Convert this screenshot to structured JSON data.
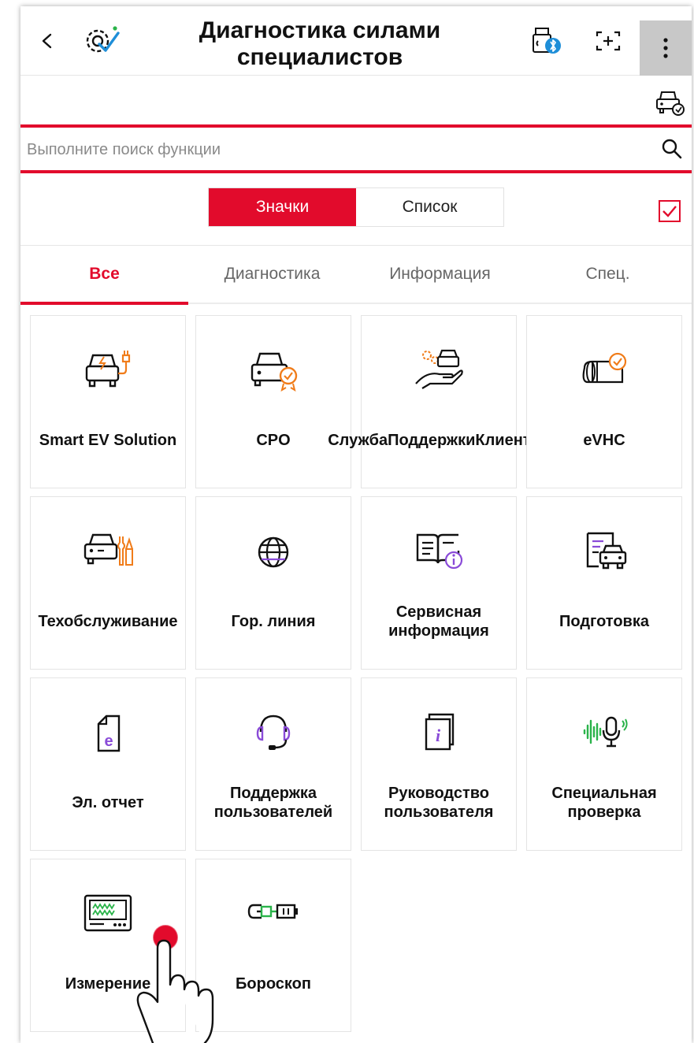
{
  "header": {
    "title": "Диагностика силами специалистов",
    "back_icon": "chevron-left-icon",
    "logo_icon": "diagnostic-gear-check-icon",
    "vci_icon": "vci-bluetooth-icon",
    "capture_icon": "screen-capture-icon",
    "more_icon": "more-vertical-icon",
    "vehicle_icon": "vehicle-clock-icon"
  },
  "search": {
    "placeholder": "Выполните поиск функции",
    "value": ""
  },
  "view_toggle": {
    "options": [
      "Значки",
      "Список"
    ],
    "selected": "Значки",
    "checkbox_checked": true
  },
  "tabs": {
    "items": [
      "Все",
      "Диагностика",
      "Информация",
      "Спец."
    ],
    "active": "Все"
  },
  "tiles": [
    {
      "label": "Smart EV Solution",
      "icon": "ev-charging-car-icon"
    },
    {
      "label": "CPO",
      "icon": "car-certified-badge-icon"
    },
    {
      "label": "СлужбаПоддержкиКлиентов",
      "icon": "customer-care-hand-icon"
    },
    {
      "label": "eVHC",
      "icon": "vehicle-health-check-icon"
    },
    {
      "label": "Техобслуживание",
      "icon": "car-maintenance-tools-icon"
    },
    {
      "label": "Гор. линия",
      "icon": "globe-icon"
    },
    {
      "label": "Сервисная информация",
      "icon": "service-info-book-icon"
    },
    {
      "label": "Подготовка",
      "icon": "document-car-icon"
    },
    {
      "label": "Эл. отчет",
      "icon": "e-report-document-icon"
    },
    {
      "label": "Поддержка пользователей",
      "icon": "headset-icon"
    },
    {
      "label": "Руководство пользователя",
      "icon": "user-manual-icon"
    },
    {
      "label": "Специальная проверка",
      "icon": "voice-microphone-icon"
    },
    {
      "label": "Измерение",
      "icon": "oscilloscope-icon"
    },
    {
      "label": "Бороскоп",
      "icon": "borescope-icon"
    }
  ],
  "colors": {
    "accent": "#e20b2c",
    "ev": "#f07c1a",
    "purple": "#8a4bd8",
    "green": "#2ab34a",
    "blue": "#1e8ed8"
  }
}
